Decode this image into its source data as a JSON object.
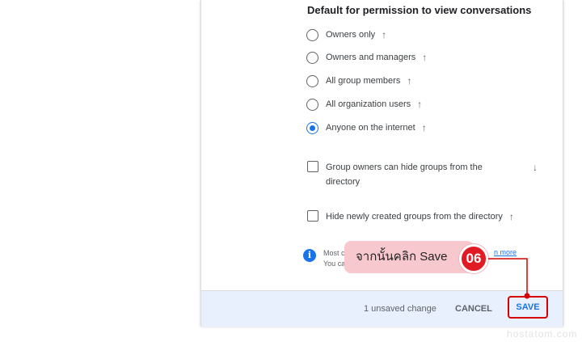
{
  "section": {
    "title": "Default for permission to view conversations"
  },
  "radio_options": [
    {
      "label": "Owners only",
      "arrow": "↑",
      "checked": false
    },
    {
      "label": "Owners and managers",
      "arrow": "↑",
      "checked": false
    },
    {
      "label": "All group members",
      "arrow": "↑",
      "checked": false
    },
    {
      "label": "All organization users",
      "arrow": "↑",
      "checked": false
    },
    {
      "label": "Anyone on the internet",
      "arrow": "↑",
      "checked": true
    }
  ],
  "checkboxes": [
    {
      "label": "Group owners can hide groups from the directory",
      "arrow": "↓",
      "checked": false
    },
    {
      "label": "Hide newly created groups from the directory",
      "arrow": "↑",
      "checked": false
    }
  ],
  "info": {
    "icon": "info-icon",
    "glyph": "i",
    "line1": "Most c",
    "line2": "You ca",
    "link": "n more"
  },
  "footer": {
    "unsaved": "1 unsaved change",
    "cancel": "CANCEL",
    "save": "SAVE"
  },
  "annotation": {
    "callout_text": "จากนั้นคลิก Save",
    "step_number": "06"
  },
  "watermark": "hostatom.com",
  "colors": {
    "accent": "#1a73e8",
    "footer_bg": "#e8f0fe",
    "highlight": "#d50000",
    "callout_bg": "#f8c8cf",
    "badge": "#e01b24"
  }
}
